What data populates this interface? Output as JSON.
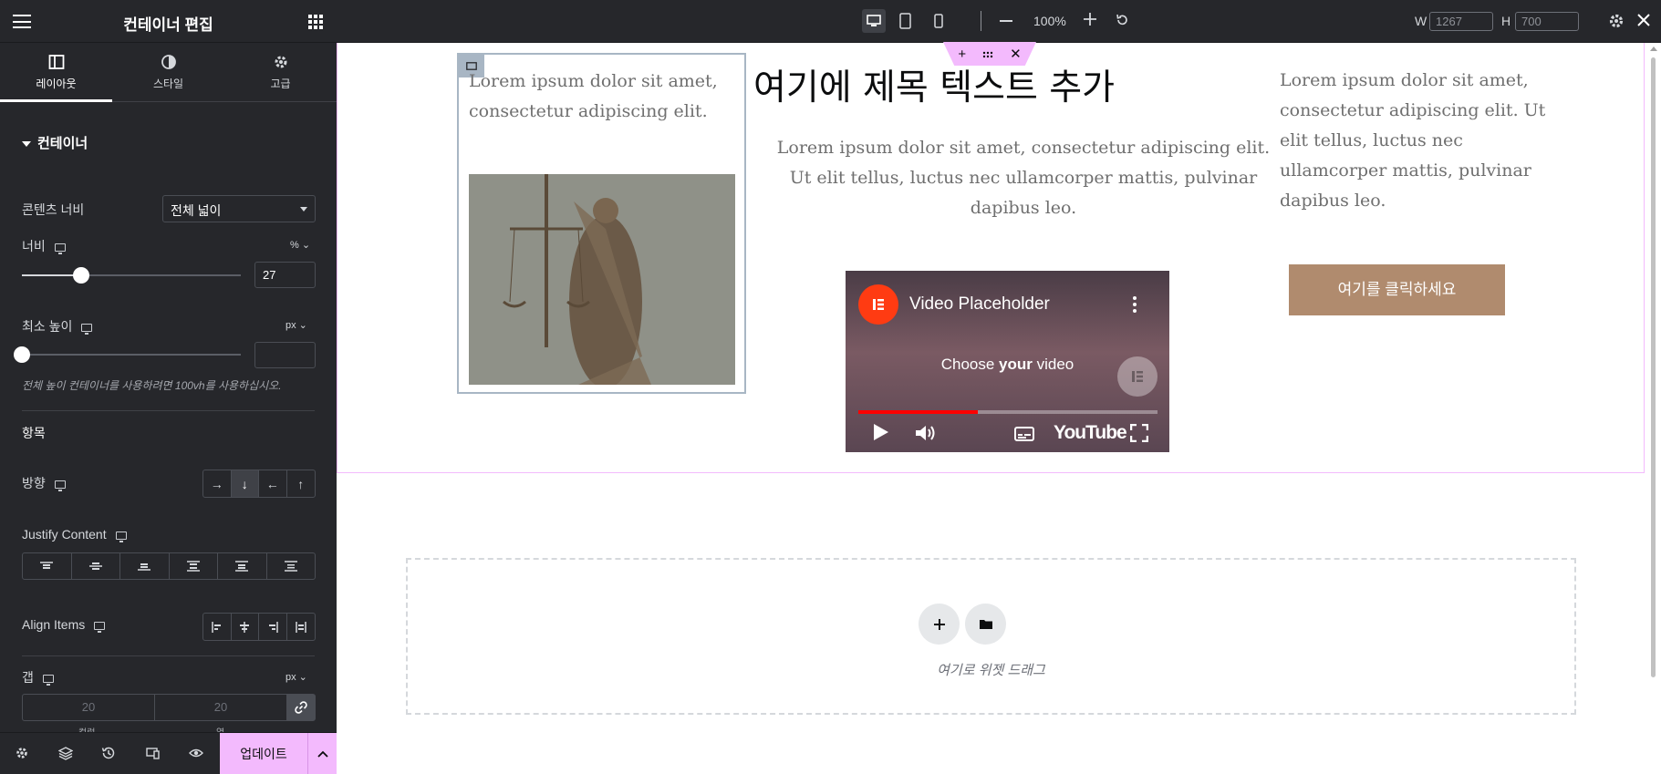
{
  "panel": {
    "title": "컨테이너 편집",
    "tabs": [
      {
        "label": "레이아웃",
        "icon": "layout-icon",
        "active": true
      },
      {
        "label": "스타일",
        "icon": "half-circle-icon",
        "active": false
      },
      {
        "label": "고급",
        "icon": "gear-icon",
        "active": false
      }
    ],
    "section_title": "컨테이너",
    "content_width": {
      "label": "콘텐츠 너비",
      "value": "전체 넓이"
    },
    "width": {
      "label": "너비",
      "unit": "%",
      "value": "27",
      "slider_fraction": 0.27
    },
    "min_height": {
      "label": "최소 높이",
      "unit": "px",
      "value": "",
      "slider_fraction": 0
    },
    "hint": "전체 높이 컨테이너를 사용하려면 100vh를 사용하십시오.",
    "items_heading": "항목",
    "direction": {
      "label": "방향",
      "options": [
        "→",
        "↓",
        "←",
        "↑"
      ],
      "selected": 1
    },
    "justify_content": {
      "label": "Justify Content"
    },
    "align_items": {
      "label": "Align Items"
    },
    "gap": {
      "label": "갭",
      "unit": "px",
      "column_placeholder": "20",
      "row_placeholder": "20",
      "column_label": "컬럼",
      "row_label": "열"
    },
    "update_label": "업데이트"
  },
  "toolbar": {
    "zoom": "100%",
    "w_label": "W",
    "w_value": "1267",
    "h_label": "H",
    "h_value": "700"
  },
  "canvas": {
    "col1_text": "Lorem ipsum dolor sit amet, consectetur adipiscing elit.",
    "heading": "여기에 제목 텍스트 추가",
    "col2_text": "Lorem ipsum dolor sit amet, consectetur adipiscing elit. Ut elit tellus, luctus nec ullamcorper mattis, pulvinar dapibus leo.",
    "video": {
      "title": "Video Placeholder",
      "subtitle_prefix": "Choose ",
      "subtitle_bold": "your",
      "subtitle_suffix": " video",
      "brand": "YouTube",
      "progress_fraction": 0.4
    },
    "col3_text": "Lorem ipsum dolor sit amet, consectetur adipiscing elit. Ut elit tellus, luctus nec ullamcorper mattis, pulvinar dapibus leo.",
    "button_label": "여기를 클릭하세요",
    "dropzone_text": "여기로 위젯 드래그"
  },
  "colors": {
    "panel_bg": "#26272b",
    "accent_pink": "#f3bafd",
    "cta_bg": "#b08b6e",
    "youtube_red": "#ff0000"
  }
}
